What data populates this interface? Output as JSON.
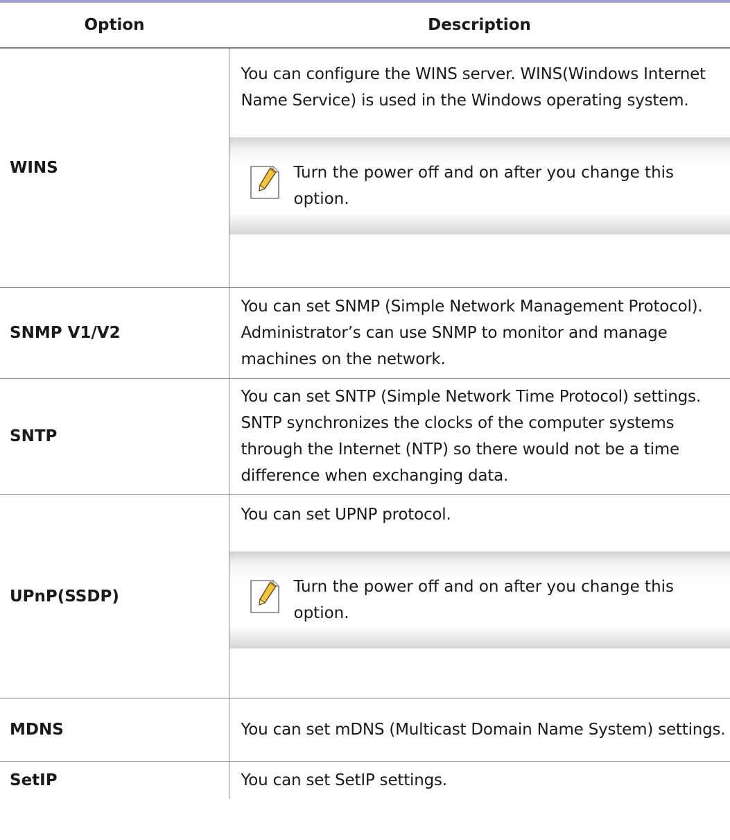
{
  "table": {
    "headers": {
      "option": "Option",
      "description": "Description"
    },
    "rows": [
      {
        "option": "WINS",
        "description": "You can configure the WINS server. WINS(Windows Internet Name Service) is used in the Windows operating system.",
        "note": "Turn the power off and on after you change this option."
      },
      {
        "option": "SNMP V1/V2",
        "description": "You can set SNMP (Simple Network Management Protocol). Administrator’s can use SNMP to monitor and manage machines on the network."
      },
      {
        "option": "SNTP",
        "description": "You can set SNTP (Simple Network Time Protocol) settings. SNTP synchronizes the clocks of the computer systems through the Internet (NTP) so there would not be a time difference when exchanging data."
      },
      {
        "option": "UPnP(SSDP)",
        "description": "You can set UPNP protocol.",
        "note": "Turn the power off and on after you change this option."
      },
      {
        "option": "MDNS",
        "description": "You can set mDNS (Multicast Domain Name System) settings."
      },
      {
        "option": "SetIP",
        "description": "You can set SetIP settings."
      }
    ]
  },
  "colors": {
    "top_rule": "#a3a1d3",
    "grid_line": "#8c8c8c"
  },
  "icons": {
    "note": "note-pencil-icon"
  }
}
